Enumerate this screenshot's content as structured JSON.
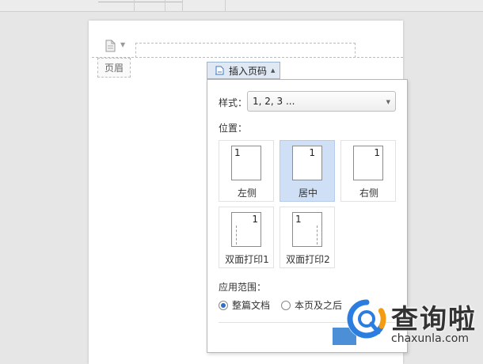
{
  "header": {
    "tag_label": "页眉"
  },
  "insert_button": {
    "label": "插入页码"
  },
  "panel": {
    "style_label": "样式：",
    "style_value": "1, 2, 3 ...",
    "position_label": "位置：",
    "positions": [
      {
        "label": "左侧",
        "num": "1",
        "align": "left",
        "selected": false,
        "duplex": false
      },
      {
        "label": "居中",
        "num": "1",
        "align": "right",
        "selected": true,
        "duplex": false
      },
      {
        "label": "右侧",
        "num": "1",
        "align": "right",
        "selected": false,
        "duplex": false
      },
      {
        "label": "双面打印1",
        "num": "1",
        "align": "right",
        "selected": false,
        "duplex": true
      },
      {
        "label": "双面打印2",
        "num": "1",
        "align": "left",
        "selected": false,
        "duplex": true
      }
    ],
    "scope_label": "应用范围：",
    "scope_options": [
      {
        "label": "整篇文档",
        "checked": true
      },
      {
        "label": "本页及之后",
        "checked": false
      }
    ]
  },
  "watermark": {
    "brand_cn": "查询啦",
    "brand_en": "chaxunla.com"
  },
  "colors": {
    "accent": "#2f6fc6",
    "selected_bg": "#cfe0f6",
    "watermark_blue": "#2b7de0",
    "watermark_orange": "#f39c12"
  }
}
